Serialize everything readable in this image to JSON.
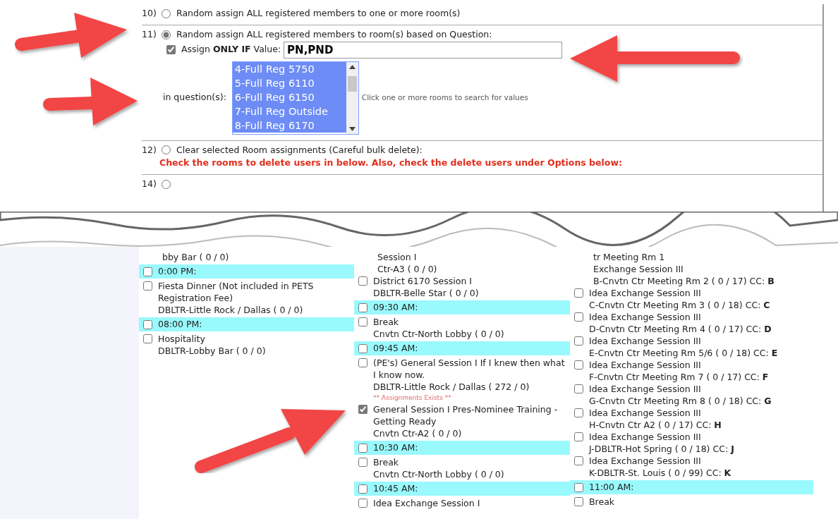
{
  "assign_options": [
    {
      "number": "10)",
      "label": "Random assign ALL registered members to one or more room(s)",
      "selected": false
    },
    {
      "number": "11)",
      "label": "Random assign ALL registered members to room(s) based on Question:",
      "selected": true,
      "condition": {
        "checked": true,
        "label": "Assign **ONLY IF** Value:",
        "value": "PN,PND",
        "question_label": "in question(s):",
        "questions": [
          {
            "label": "4-Full Reg 5750",
            "selected": true
          },
          {
            "label": "5-Full Reg 6110",
            "selected": true
          },
          {
            "label": "6-Full Reg 6150",
            "selected": true
          },
          {
            "label": "7-Full Reg Outside",
            "selected": true
          },
          {
            "label": "8-Full Reg 6170",
            "selected": true
          }
        ],
        "hint": "Click one or more rooms to search for values"
      }
    },
    {
      "number": "12)",
      "label": "Clear selected Room assignments (Careful bulk delete):",
      "selected": false,
      "warning": "Check the rooms to delete users in below. Also, check the delete users under Options below:"
    },
    {
      "number": "14)",
      "selected": false
    }
  ],
  "room_columns": [
    [
      {
        "kind": "session",
        "lines": [
          "bby Bar ( 0 / 0)"
        ]
      },
      {
        "kind": "time",
        "label": "0:00 PM:",
        "checked": false
      },
      {
        "kind": "session",
        "checked": false,
        "lines": [
          "Fiesta Dinner (Not included in PETS Registration Fee)",
          "DBLTR-Little Rock / Dallas ( 0 / 0)"
        ]
      },
      {
        "kind": "time",
        "label": "08:00 PM:",
        "checked": false
      },
      {
        "kind": "session",
        "checked": false,
        "lines": [
          "Hospitality",
          "DBLTR-Lobby Bar ( 0 / 0)"
        ]
      }
    ],
    [
      {
        "kind": "session",
        "lines": [
          "Session I",
          "Ctr-A3 ( 0 / 0)"
        ]
      },
      {
        "kind": "session",
        "checked": false,
        "lines": [
          "District 6170 Session I",
          "DBLTR-Belle Star ( 0 / 0)"
        ]
      },
      {
        "kind": "time",
        "label": "09:30 AM:",
        "checked": false
      },
      {
        "kind": "session",
        "checked": false,
        "lines": [
          "Break",
          "Cnvtn Ctr-North Lobby ( 0 / 0)"
        ]
      },
      {
        "kind": "time",
        "label": "09:45 AM:",
        "checked": false
      },
      {
        "kind": "session",
        "checked": false,
        "lines": [
          "(PE's) General Session I If I knew then what I know now.",
          "DBLTR-Little Rock / Dallas ( 272 / 0)"
        ]
      },
      {
        "kind": "note",
        "label": "** Assignments Exists **"
      },
      {
        "kind": "session",
        "checked": true,
        "lines": [
          "General Session I Pres-Nominee Training - Getting Ready",
          "Cnvtn Ctr-A2 ( 0 / 0)"
        ]
      },
      {
        "kind": "time",
        "label": "10:30 AM:",
        "checked": false
      },
      {
        "kind": "session",
        "checked": false,
        "lines": [
          "Break",
          "Cnvtn Ctr-North Lobby ( 0 / 0)"
        ]
      },
      {
        "kind": "time",
        "label": "10:45 AM:",
        "checked": false
      },
      {
        "kind": "session",
        "checked": false,
        "lines": [
          "Idea Exchange Session I"
        ]
      }
    ],
    [
      {
        "kind": "session",
        "lines": [
          "tr Meeting Rm 1",
          "Exchange Session III",
          "B-Cnvtn Ctr Meeting Rm 2 ( 0 / 17) CC: **B**"
        ]
      },
      {
        "kind": "session",
        "checked": false,
        "lines": [
          "Idea Exchange Session III",
          "C-Cnvtn Ctr Meeting Rm 3 ( 0 / 18) CC: **C**"
        ]
      },
      {
        "kind": "session",
        "checked": false,
        "lines": [
          "Idea Exchange Session III",
          "D-Cnvtn Ctr Meeting Rm 4 ( 0 / 17) CC: **D**"
        ]
      },
      {
        "kind": "session",
        "checked": false,
        "lines": [
          "Idea Exchange Session III",
          "E-Cnvtn Ctr Meeting Rm 5/6 ( 0 / 18) CC: **E**"
        ]
      },
      {
        "kind": "session",
        "checked": false,
        "lines": [
          "Idea Exchange Session III",
          "F-Cnvtn Ctr Meeting Rm 7 ( 0 / 17) CC: **F**"
        ]
      },
      {
        "kind": "session",
        "checked": false,
        "lines": [
          "Idea Exchange Session III",
          "G-Cnvtn Ctr Meeting Rm 8 ( 0 / 18) CC: **G**"
        ]
      },
      {
        "kind": "session",
        "checked": false,
        "lines": [
          "Idea Exchange Session III",
          "H-Cnvtn Ctr A2 ( 0 / 17) CC: **H**"
        ]
      },
      {
        "kind": "session",
        "checked": false,
        "lines": [
          "Idea Exchange Session III",
          "J-DBLTR-Hot Spring ( 0 / 18) CC: **J**"
        ]
      },
      {
        "kind": "session",
        "checked": false,
        "lines": [
          "Idea Exchange Session III",
          "K-DBLTR-St. Louis ( 0 / 99) CC: **K**"
        ]
      },
      {
        "kind": "time",
        "label": "11:00 AM:",
        "checked": false
      },
      {
        "kind": "session",
        "checked": false,
        "lines": [
          "Break"
        ]
      }
    ]
  ]
}
